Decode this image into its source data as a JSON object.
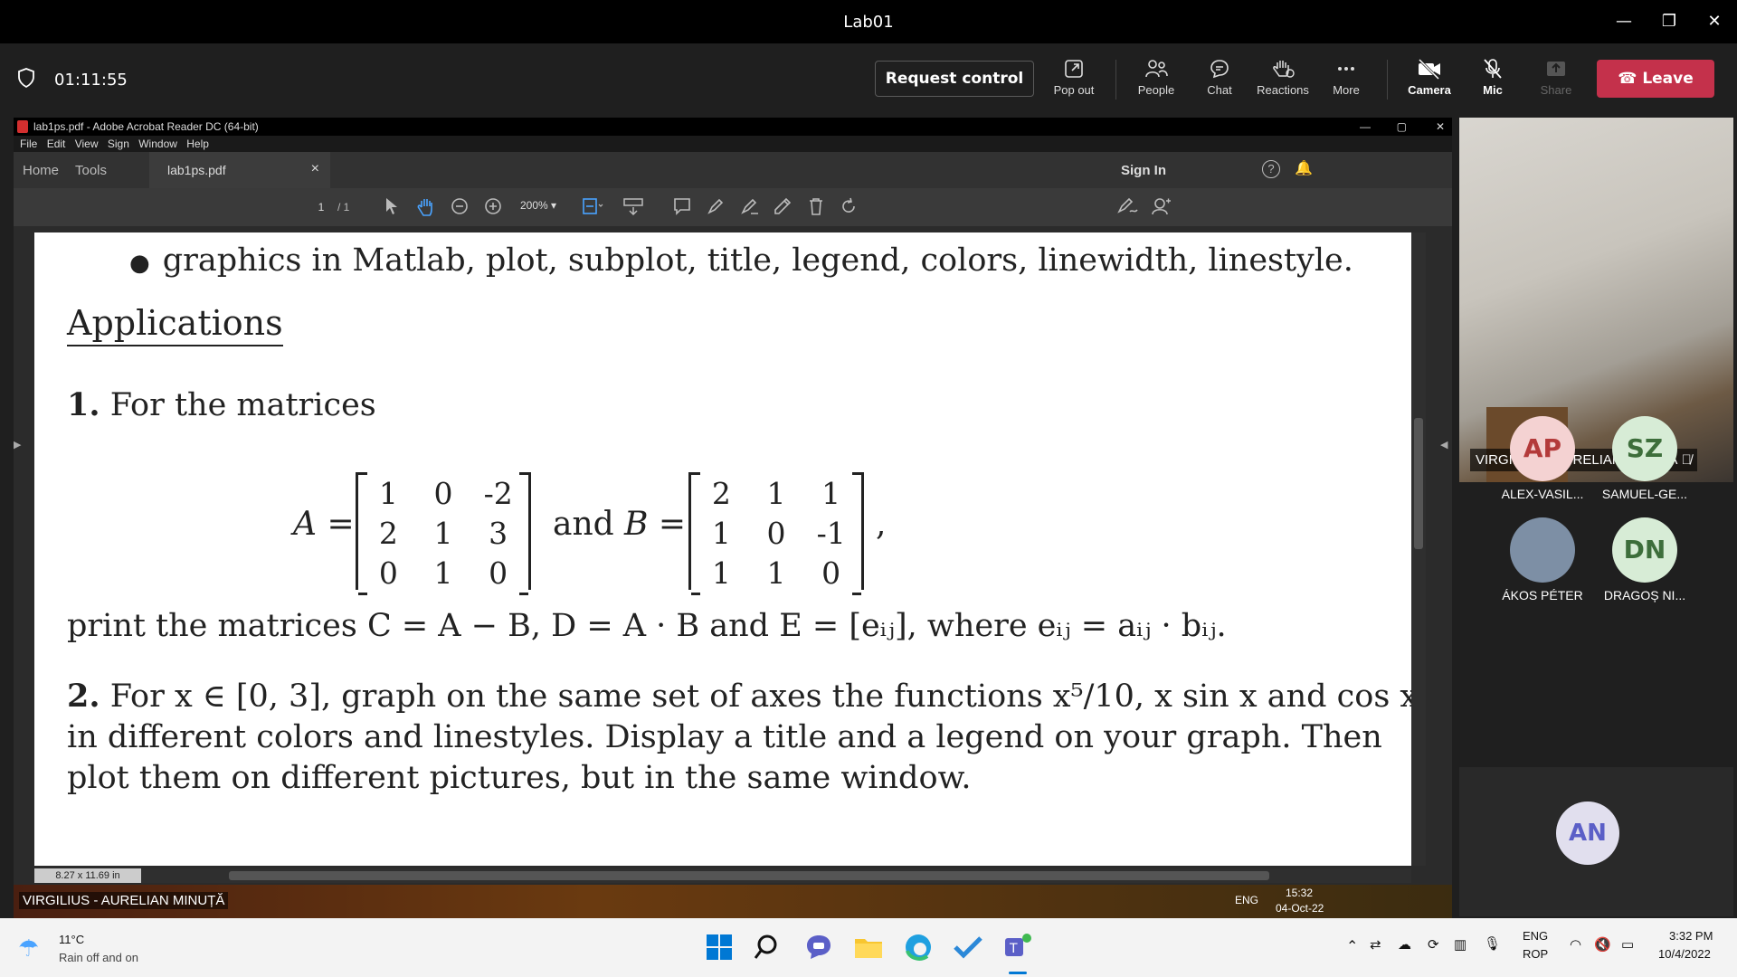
{
  "window": {
    "title": "Lab01"
  },
  "meeting": {
    "timer": "01:11:55",
    "request_control": "Request control",
    "buttons": [
      "Pop out",
      "People",
      "Chat",
      "Reactions",
      "More",
      "Camera",
      "Mic",
      "Share"
    ],
    "leave": "Leave"
  },
  "acrobat": {
    "title": "lab1ps.pdf - Adobe Acrobat Reader DC (64-bit)",
    "menu": [
      "File",
      "Edit",
      "View",
      "Sign",
      "Window",
      "Help"
    ],
    "tabs": {
      "home": "Home",
      "tools": "Tools",
      "doc": "lab1ps.pdf",
      "close": "×",
      "sign_in": "Sign In"
    },
    "page_num": "1",
    "page_total": "/ 1",
    "zoom": "200%",
    "page_size": "8.27 x 11.69 in"
  },
  "doc": {
    "bullet": "graphics in Matlab, plot, subplot, title, legend, colors, linewidth, linestyle.",
    "heading": "Applications",
    "p1_num": "1.",
    "p1": "For the matrices",
    "matA_label": "A =",
    "matA": [
      [
        "1",
        "0",
        "-2"
      ],
      [
        "2",
        "1",
        "3"
      ],
      [
        "0",
        "1",
        "0"
      ]
    ],
    "and": "and",
    "matB_label": "B =",
    "matB": [
      [
        "2",
        "1",
        "1"
      ],
      [
        "1",
        "0",
        "-1"
      ],
      [
        "1",
        "1",
        "0"
      ]
    ],
    "comma": ",",
    "p1b": "print the matrices C = A − B, D = A · B and E = [eᵢⱼ], where eᵢⱼ = aᵢⱼ · bᵢⱼ.",
    "p2_num": "2.",
    "p2_l1": "For x ∈ [0, 3], graph on the same set of axes the functions x⁵/10, x sin x and cos x,",
    "p2_l2": "in different colors and linestyles. Display a title and a legend on your graph. Then",
    "p2_l3": "plot them on different pictures, but in the same window."
  },
  "inner_taskbar": {
    "presenter": "VIRGILIUS - AURELIAN MINUȚĂ",
    "lang": "ENG",
    "time": "15:32",
    "date": "04-Oct-22"
  },
  "participants": {
    "video_name": "VIRGILIUS - AURELIAN MINUȚĂ",
    "tiles": [
      {
        "initials": "AP",
        "name": "ALEX-VASIL...",
        "bg": "#f4d2d2",
        "fg": "#b33a3a"
      },
      {
        "initials": "SZ",
        "name": "SAMUEL-GE...",
        "bg": "#d7ecd6",
        "fg": "#3d6e3b"
      },
      {
        "initials": "",
        "name": "ÁKOS PÉTER",
        "bg": "#7d8fa5",
        "fg": "#fff"
      },
      {
        "initials": "DN",
        "name": "DRAGOȘ NI...",
        "bg": "#d7ecd6",
        "fg": "#3d6e3b"
      }
    ],
    "an": "AN"
  },
  "taskbar": {
    "temp": "11°C",
    "weather": "Rain off and on",
    "lang1": "ENG",
    "lang2": "ROP",
    "time": "3:32 PM",
    "date": "10/4/2022"
  }
}
